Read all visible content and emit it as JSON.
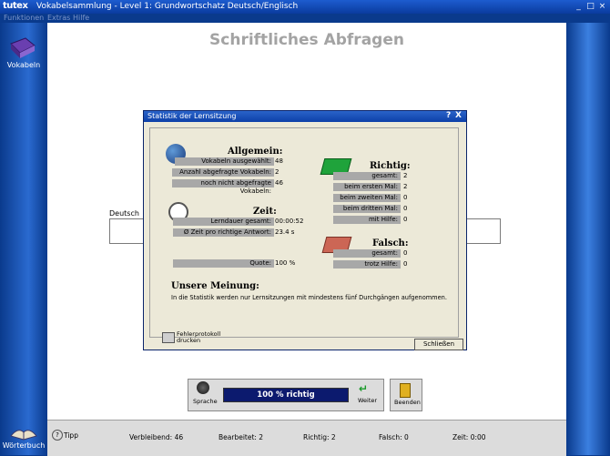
{
  "app": {
    "logo": "tutex",
    "window_title": "Vokabelsammlung - Level 1: Grundwortschatz Deutsch/Englisch",
    "menu": [
      "Funktionen",
      "Extras",
      "Hilfe"
    ]
  },
  "sidebar": {
    "top_label": "Vokabeln",
    "bottom_label": "Wörterbuch"
  },
  "main": {
    "title": "Schriftliches Abfragen",
    "field_label": "Deutsch",
    "field_value": ""
  },
  "dialog": {
    "title": "Statistik der Lernsitzung",
    "help_glyph": "?",
    "close_glyph": "X",
    "allgemein": {
      "heading": "Allgemein:",
      "rows": [
        {
          "label": "Vokabeln ausgewählt:",
          "value": "48"
        },
        {
          "label": "Anzahl abgefragte Vokabeln:",
          "value": "2"
        },
        {
          "label": "noch nicht abgefragte Vokabeln:",
          "value": "46"
        }
      ]
    },
    "zeit": {
      "heading": "Zeit:",
      "rows": [
        {
          "label": "Lerndauer gesamt:",
          "value": "00:00:52"
        },
        {
          "label": "Ø  Zeit pro richtige Antwort:",
          "value": "23.4 s"
        }
      ]
    },
    "quote": {
      "label": "Quote:",
      "value": "100 %"
    },
    "richtig": {
      "heading": "Richtig:",
      "rows": [
        {
          "label": "gesamt:",
          "value": "2"
        },
        {
          "label": "beim ersten Mal:",
          "value": "2"
        },
        {
          "label": "beim zweiten Mal:",
          "value": "0"
        },
        {
          "label": "beim dritten Mal:",
          "value": "0"
        },
        {
          "label": "mit Hilfe:",
          "value": "0"
        }
      ]
    },
    "falsch": {
      "heading": "Falsch:",
      "rows": [
        {
          "label": "gesamt:",
          "value": "0"
        },
        {
          "label": "trotz Hilfe:",
          "value": "0"
        }
      ]
    },
    "meinung": {
      "heading": "Unsere Meinung:",
      "text": "In die Statistik werden nur Lernsitzungen mit mindestens fünf Durchgängen aufgenommen."
    },
    "print_button": {
      "line1": "Fehlerprotokoll",
      "line2": "drucken"
    },
    "close_button": "Schließen"
  },
  "controls": {
    "speaker_label": "Sprache",
    "progress_text": "100 % richtig",
    "progress_fraction": 1.0,
    "next_label": "Weiter",
    "end_label": "Beenden"
  },
  "status": {
    "tipp": "Tipp",
    "verbleibend": "Verbleibend: 46",
    "bearbeitet": "Bearbeitet: 2",
    "richtig": "Richtig: 2",
    "falsch": "Falsch: 0",
    "zeit": "Zeit: 0:00"
  },
  "colors": {
    "titlebar": "#1d5ccf",
    "sidebar": "#0a3a8c",
    "progress_bg": "#0c1a6e",
    "richtig_box": "#1fa33b",
    "falsch_box": "#cc6655"
  }
}
